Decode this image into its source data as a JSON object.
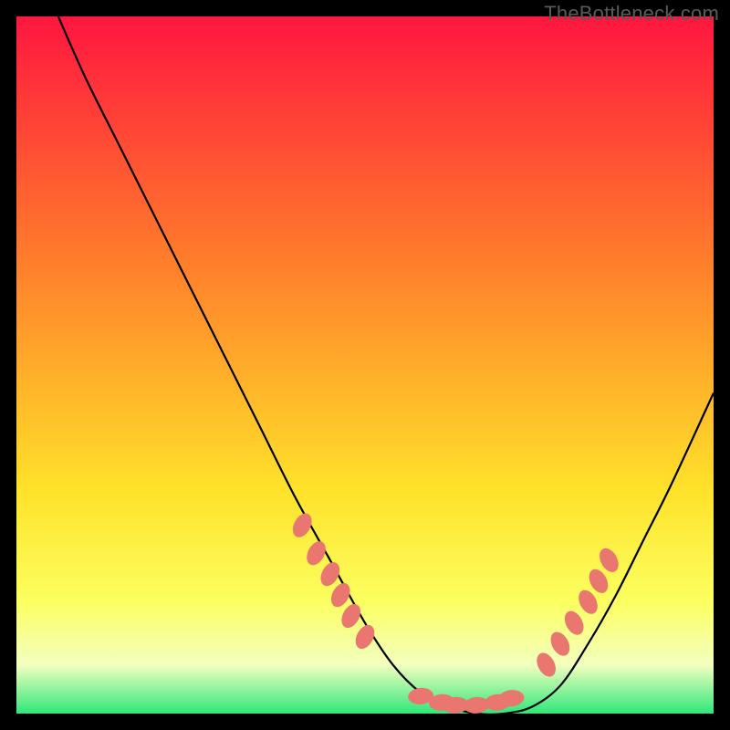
{
  "watermark": "TheBottleneck.com",
  "colors": {
    "gradient_top": "#ff163f",
    "gradient_mid1": "#ff7d2b",
    "gradient_mid2": "#ffe22a",
    "gradient_mid3": "#fbff60",
    "gradient_low": "#f3ffbf",
    "gradient_bottom": "#2fe77a",
    "curve": "#000000",
    "marker": "#e9776f",
    "frame": "#000000"
  },
  "chart_data": {
    "type": "line",
    "title": "",
    "xlabel": "",
    "ylabel": "",
    "xlim": [
      0,
      100
    ],
    "ylim": [
      0,
      100
    ],
    "series": [
      {
        "name": "bottleneck-curve",
        "x": [
          6,
          10,
          15,
          20,
          25,
          30,
          35,
          40,
          45,
          50,
          54,
          58,
          62,
          66,
          70,
          74,
          78,
          82,
          86,
          90,
          94,
          100
        ],
        "y": [
          100,
          91,
          81,
          71,
          61,
          51,
          41,
          31,
          22,
          13,
          7,
          3,
          1,
          0,
          0,
          1,
          4,
          10,
          17,
          25,
          33,
          46
        ]
      }
    ],
    "markers": [
      {
        "name": "left-cluster",
        "points": [
          {
            "x": 41,
            "y": 27
          },
          {
            "x": 43,
            "y": 23
          },
          {
            "x": 45,
            "y": 20
          },
          {
            "x": 46.5,
            "y": 17
          },
          {
            "x": 48,
            "y": 14
          },
          {
            "x": 50,
            "y": 11
          }
        ]
      },
      {
        "name": "bottom-cluster",
        "points": [
          {
            "x": 58,
            "y": 2.5
          },
          {
            "x": 61,
            "y": 1.6
          },
          {
            "x": 63,
            "y": 1.2
          },
          {
            "x": 66,
            "y": 1.2
          },
          {
            "x": 69,
            "y": 1.6
          },
          {
            "x": 71,
            "y": 2.2
          }
        ]
      },
      {
        "name": "right-cluster",
        "points": [
          {
            "x": 76,
            "y": 7
          },
          {
            "x": 78,
            "y": 10
          },
          {
            "x": 80,
            "y": 13
          },
          {
            "x": 82,
            "y": 16
          },
          {
            "x": 83.5,
            "y": 19
          },
          {
            "x": 85,
            "y": 22
          }
        ]
      }
    ]
  }
}
